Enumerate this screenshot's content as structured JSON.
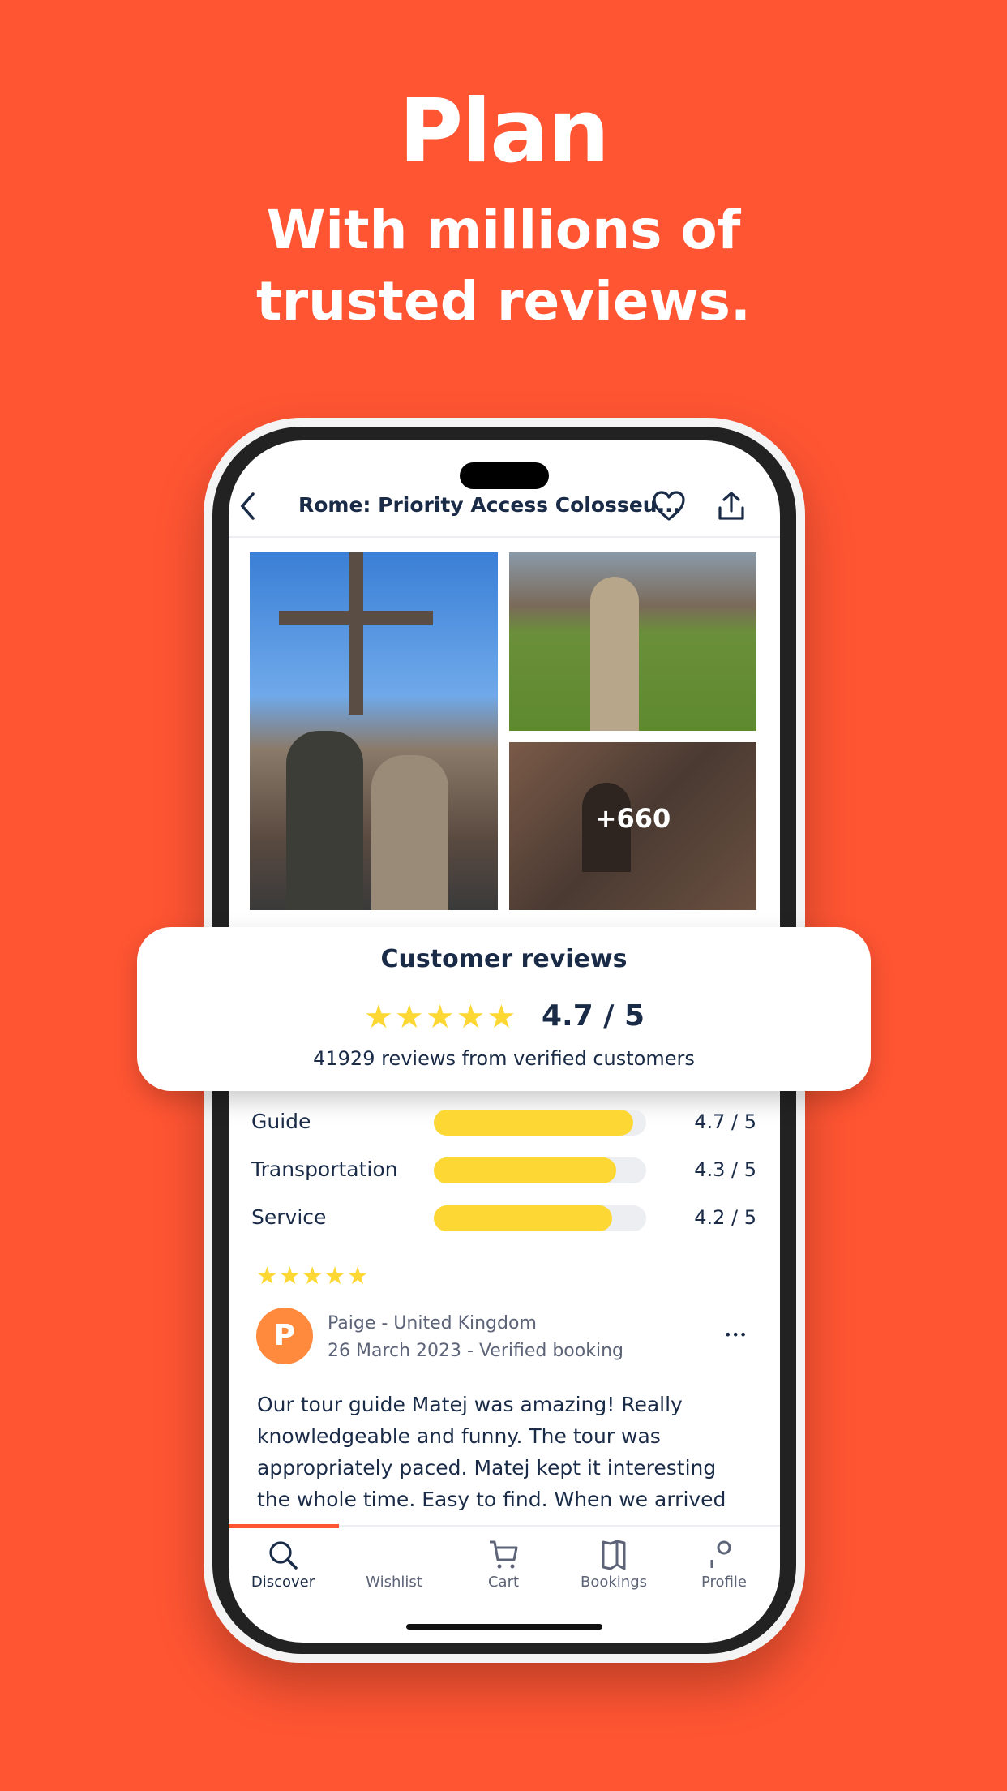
{
  "headline": {
    "title": "Plan",
    "line1": "With millions of",
    "line2": "trusted reviews."
  },
  "header": {
    "title": "Rome: Priority Access Colosseu...",
    "back_icon": "chevron-left-icon",
    "wishlist_icon": "heart-icon",
    "share_icon": "share-icon"
  },
  "gallery": {
    "more_count": "+660"
  },
  "reviews_card": {
    "title": "Customer reviews",
    "rating": "4.7 / 5",
    "stars": 5,
    "summary": "41929 reviews from verified customers"
  },
  "ratings": [
    {
      "label": "Guide",
      "value": "4.7 / 5",
      "score": 4.7
    },
    {
      "label": "Transportation",
      "value": "4.3 / 5",
      "score": 4.3
    },
    {
      "label": "Service",
      "value": "4.2 / 5",
      "score": 4.2
    }
  ],
  "review": {
    "stars": 5,
    "avatar_letter": "P",
    "author": "Paige - United Kingdom",
    "meta": "26 March 2023 - Verified booking",
    "more": "•••",
    "text": "Our tour guide Matej was amazing! Really knowledgeable and funny. The tour was appropriately paced. Matej kept it interesting the whole time. Easy to find. When we arrived to the"
  },
  "tabs": [
    {
      "label": "Discover",
      "icon": "search-icon",
      "active": true
    },
    {
      "label": "Wishlist",
      "icon": "heart-icon"
    },
    {
      "label": "Cart",
      "icon": "cart-icon"
    },
    {
      "label": "Bookings",
      "icon": "bookings-icon"
    },
    {
      "label": "Profile",
      "icon": "profile-icon"
    }
  ],
  "colors": {
    "background": "#FF5533",
    "star": "#FDD835",
    "avatar": "#FF8A3D",
    "text": "#1A2B48",
    "active_tab": "#FF5533"
  }
}
